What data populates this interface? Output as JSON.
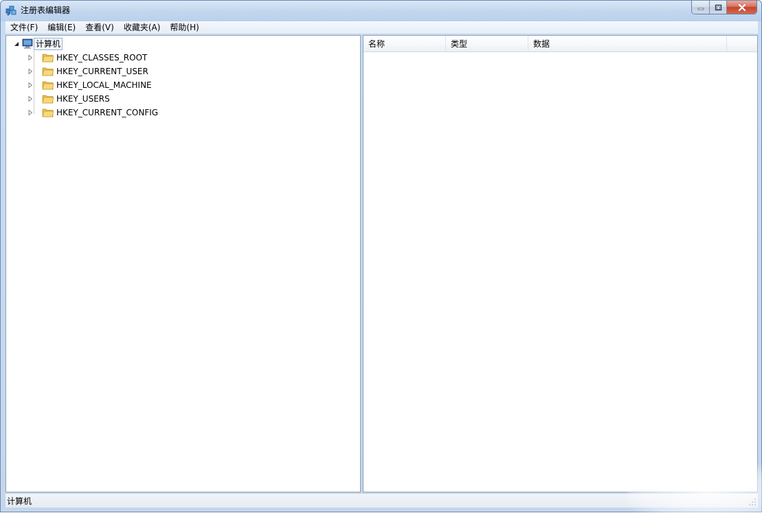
{
  "window": {
    "title": "注册表编辑器",
    "icon": "regedit-icon"
  },
  "caption": {
    "minimize_icon": "minimize-icon",
    "maximize_icon": "restore-icon",
    "close_icon": "close-icon"
  },
  "menu": [
    {
      "label": "文件(F)"
    },
    {
      "label": "编辑(E)"
    },
    {
      "label": "查看(V)"
    },
    {
      "label": "收藏夹(A)"
    },
    {
      "label": "帮助(H)"
    }
  ],
  "tree": {
    "root": {
      "label": "计算机",
      "icon": "computer-icon",
      "expanded": true
    },
    "children": [
      {
        "label": "HKEY_CLASSES_ROOT"
      },
      {
        "label": "HKEY_CURRENT_USER"
      },
      {
        "label": "HKEY_LOCAL_MACHINE"
      },
      {
        "label": "HKEY_USERS"
      },
      {
        "label": "HKEY_CURRENT_CONFIG"
      }
    ]
  },
  "list": {
    "columns": [
      {
        "label": "名称"
      },
      {
        "label": "类型"
      },
      {
        "label": "数据"
      }
    ]
  },
  "status": {
    "path": "计算机"
  },
  "colors": {
    "title_bg": "#c3d7ef",
    "close_red": "#c4452c",
    "folder_yellow": "#f2cf6a"
  }
}
